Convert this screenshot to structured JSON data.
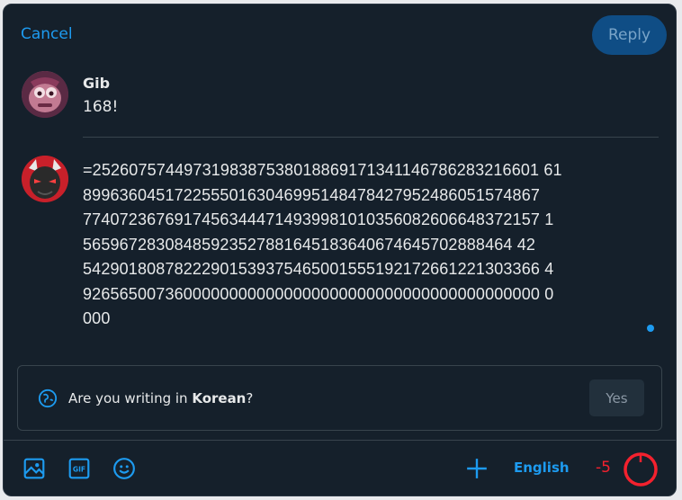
{
  "header": {
    "cancel_label": "Cancel",
    "reply_label": "Reply"
  },
  "original_post": {
    "author": "Gib",
    "text": "168!"
  },
  "compose": {
    "lines": [
      "=2526075744973198387538018869171341146786283216601 61",
      "89963604517225550163046995148478427952486051574867",
      "77407236769174563444714939981010356082606648372157 1",
      "56596728308485923527881645183640674645702888464 42",
      "54290180878222901539375465001555192172661221303366 4",
      "92656500736000000000000000000000000000000000000000 0",
      "000"
    ]
  },
  "language_prompt": {
    "prefix": "Are you writing in ",
    "language": "Korean",
    "suffix": "?",
    "yes_label": "Yes"
  },
  "footer": {
    "language_label": "English",
    "remaining_chars": "-5"
  },
  "colors": {
    "accent": "#1d9bf0",
    "danger": "#f4212e",
    "background": "#15202b"
  },
  "icons": [
    "image-icon",
    "gif-icon",
    "emoji-icon",
    "globe-icon",
    "plus-icon",
    "progress-ring-icon"
  ]
}
